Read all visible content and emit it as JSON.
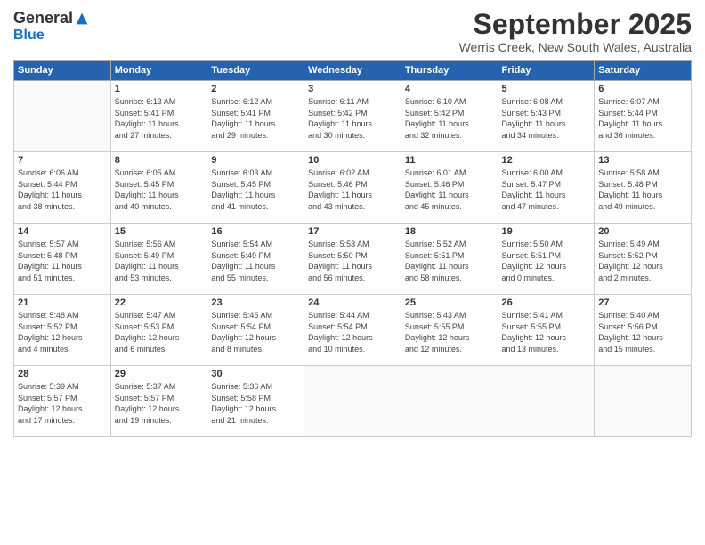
{
  "header": {
    "logo_general": "General",
    "logo_blue": "Blue",
    "month_title": "September 2025",
    "location": "Werris Creek, New South Wales, Australia"
  },
  "weekdays": [
    "Sunday",
    "Monday",
    "Tuesday",
    "Wednesday",
    "Thursday",
    "Friday",
    "Saturday"
  ],
  "weeks": [
    [
      {
        "day": "",
        "info": ""
      },
      {
        "day": "1",
        "info": "Sunrise: 6:13 AM\nSunset: 5:41 PM\nDaylight: 11 hours\nand 27 minutes."
      },
      {
        "day": "2",
        "info": "Sunrise: 6:12 AM\nSunset: 5:41 PM\nDaylight: 11 hours\nand 29 minutes."
      },
      {
        "day": "3",
        "info": "Sunrise: 6:11 AM\nSunset: 5:42 PM\nDaylight: 11 hours\nand 30 minutes."
      },
      {
        "day": "4",
        "info": "Sunrise: 6:10 AM\nSunset: 5:42 PM\nDaylight: 11 hours\nand 32 minutes."
      },
      {
        "day": "5",
        "info": "Sunrise: 6:08 AM\nSunset: 5:43 PM\nDaylight: 11 hours\nand 34 minutes."
      },
      {
        "day": "6",
        "info": "Sunrise: 6:07 AM\nSunset: 5:44 PM\nDaylight: 11 hours\nand 36 minutes."
      }
    ],
    [
      {
        "day": "7",
        "info": "Sunrise: 6:06 AM\nSunset: 5:44 PM\nDaylight: 11 hours\nand 38 minutes."
      },
      {
        "day": "8",
        "info": "Sunrise: 6:05 AM\nSunset: 5:45 PM\nDaylight: 11 hours\nand 40 minutes."
      },
      {
        "day": "9",
        "info": "Sunrise: 6:03 AM\nSunset: 5:45 PM\nDaylight: 11 hours\nand 41 minutes."
      },
      {
        "day": "10",
        "info": "Sunrise: 6:02 AM\nSunset: 5:46 PM\nDaylight: 11 hours\nand 43 minutes."
      },
      {
        "day": "11",
        "info": "Sunrise: 6:01 AM\nSunset: 5:46 PM\nDaylight: 11 hours\nand 45 minutes."
      },
      {
        "day": "12",
        "info": "Sunrise: 6:00 AM\nSunset: 5:47 PM\nDaylight: 11 hours\nand 47 minutes."
      },
      {
        "day": "13",
        "info": "Sunrise: 5:58 AM\nSunset: 5:48 PM\nDaylight: 11 hours\nand 49 minutes."
      }
    ],
    [
      {
        "day": "14",
        "info": "Sunrise: 5:57 AM\nSunset: 5:48 PM\nDaylight: 11 hours\nand 51 minutes."
      },
      {
        "day": "15",
        "info": "Sunrise: 5:56 AM\nSunset: 5:49 PM\nDaylight: 11 hours\nand 53 minutes."
      },
      {
        "day": "16",
        "info": "Sunrise: 5:54 AM\nSunset: 5:49 PM\nDaylight: 11 hours\nand 55 minutes."
      },
      {
        "day": "17",
        "info": "Sunrise: 5:53 AM\nSunset: 5:50 PM\nDaylight: 11 hours\nand 56 minutes."
      },
      {
        "day": "18",
        "info": "Sunrise: 5:52 AM\nSunset: 5:51 PM\nDaylight: 11 hours\nand 58 minutes."
      },
      {
        "day": "19",
        "info": "Sunrise: 5:50 AM\nSunset: 5:51 PM\nDaylight: 12 hours\nand 0 minutes."
      },
      {
        "day": "20",
        "info": "Sunrise: 5:49 AM\nSunset: 5:52 PM\nDaylight: 12 hours\nand 2 minutes."
      }
    ],
    [
      {
        "day": "21",
        "info": "Sunrise: 5:48 AM\nSunset: 5:52 PM\nDaylight: 12 hours\nand 4 minutes."
      },
      {
        "day": "22",
        "info": "Sunrise: 5:47 AM\nSunset: 5:53 PM\nDaylight: 12 hours\nand 6 minutes."
      },
      {
        "day": "23",
        "info": "Sunrise: 5:45 AM\nSunset: 5:54 PM\nDaylight: 12 hours\nand 8 minutes."
      },
      {
        "day": "24",
        "info": "Sunrise: 5:44 AM\nSunset: 5:54 PM\nDaylight: 12 hours\nand 10 minutes."
      },
      {
        "day": "25",
        "info": "Sunrise: 5:43 AM\nSunset: 5:55 PM\nDaylight: 12 hours\nand 12 minutes."
      },
      {
        "day": "26",
        "info": "Sunrise: 5:41 AM\nSunset: 5:55 PM\nDaylight: 12 hours\nand 13 minutes."
      },
      {
        "day": "27",
        "info": "Sunrise: 5:40 AM\nSunset: 5:56 PM\nDaylight: 12 hours\nand 15 minutes."
      }
    ],
    [
      {
        "day": "28",
        "info": "Sunrise: 5:39 AM\nSunset: 5:57 PM\nDaylight: 12 hours\nand 17 minutes."
      },
      {
        "day": "29",
        "info": "Sunrise: 5:37 AM\nSunset: 5:57 PM\nDaylight: 12 hours\nand 19 minutes."
      },
      {
        "day": "30",
        "info": "Sunrise: 5:36 AM\nSunset: 5:58 PM\nDaylight: 12 hours\nand 21 minutes."
      },
      {
        "day": "",
        "info": ""
      },
      {
        "day": "",
        "info": ""
      },
      {
        "day": "",
        "info": ""
      },
      {
        "day": "",
        "info": ""
      }
    ]
  ]
}
